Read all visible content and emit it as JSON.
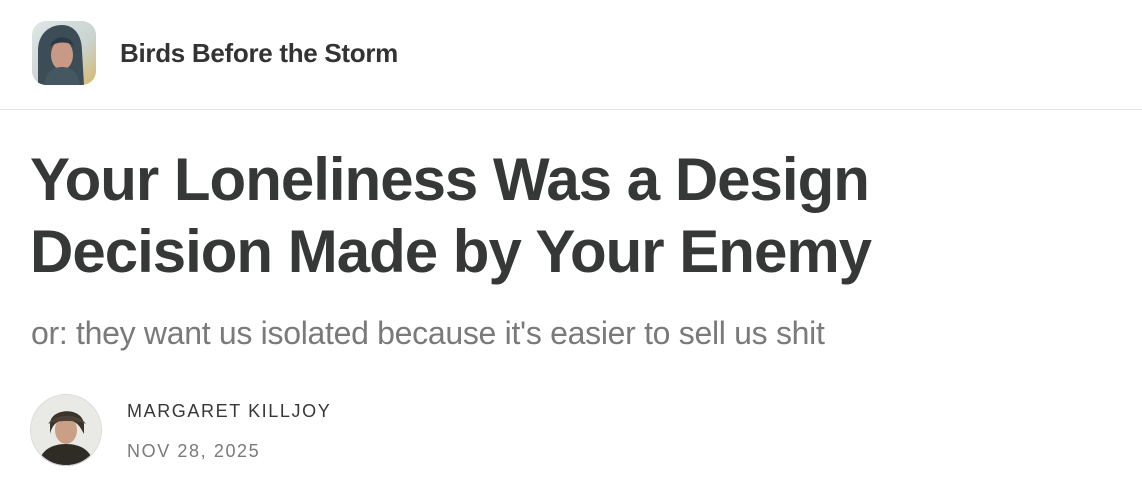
{
  "header": {
    "publication_name": "Birds Before the Storm",
    "logo_icon": "publication-logo-portrait"
  },
  "post": {
    "title": "Your Loneliness Was a Design Decision Made by Your Enemy",
    "subtitle": "or: they want us isolated because it's easier to sell us shit"
  },
  "byline": {
    "author_name": "MARGARET KILLJOY",
    "date": "NOV 28, 2025",
    "avatar_icon": "author-avatar-portrait"
  },
  "colors": {
    "title": "#363737",
    "subtitle": "#7a7a7a",
    "divider": "#e3e3e3"
  }
}
